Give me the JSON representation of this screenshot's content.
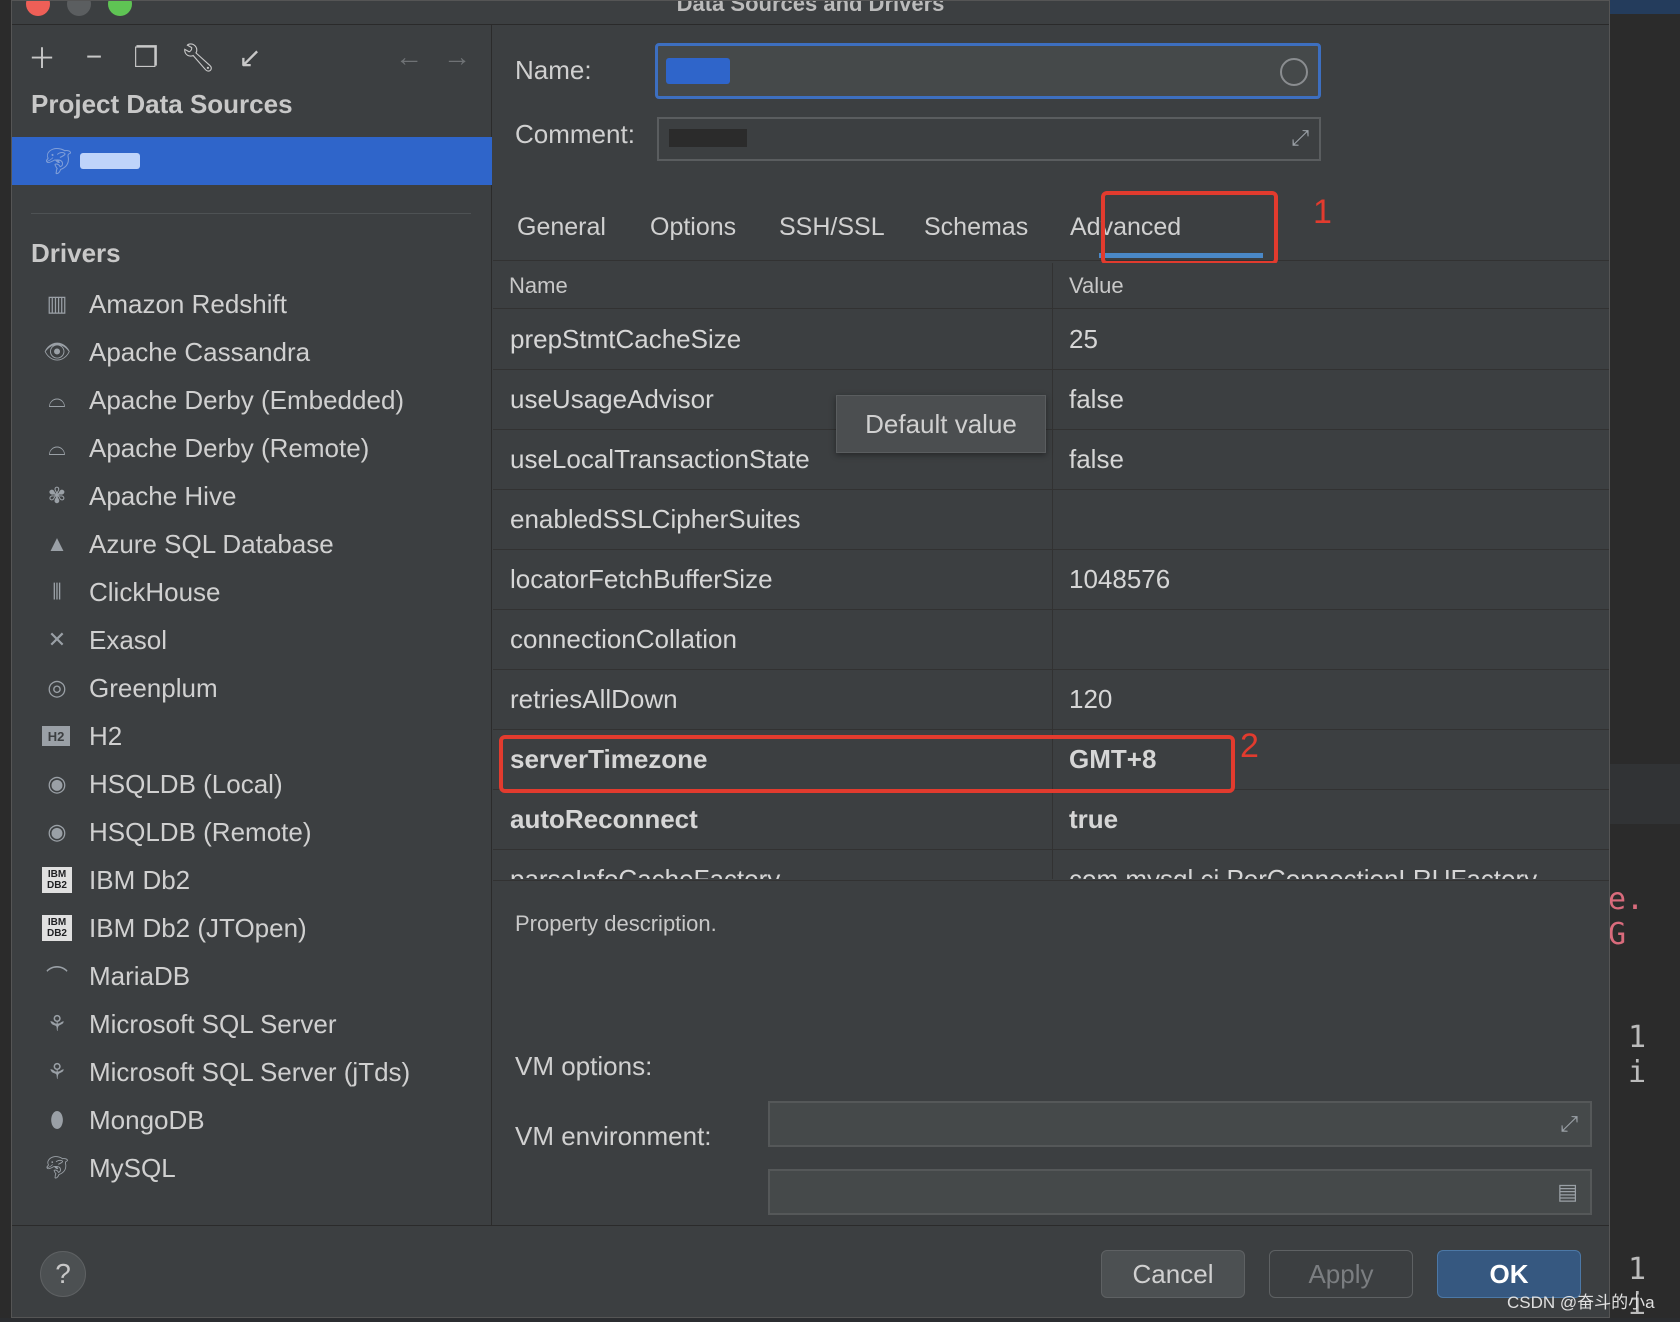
{
  "window": {
    "title": "Data Sources and Drivers"
  },
  "toolbar": {
    "add_icon": "plus-icon",
    "remove_icon": "minus-icon",
    "duplicate_icon": "copy-icon",
    "settings_icon": "wrench-icon",
    "import_icon": "import-icon",
    "back_icon": "arrow-left-icon",
    "forward_icon": "arrow-right-icon"
  },
  "sidebar": {
    "project_title": "Project Data Sources",
    "drivers_title": "Drivers",
    "drivers": [
      {
        "label": "Amazon Redshift",
        "icon": "redshift-icon"
      },
      {
        "label": "Apache Cassandra",
        "icon": "eye-icon"
      },
      {
        "label": "Apache Derby (Embedded)",
        "icon": "hat-icon"
      },
      {
        "label": "Apache Derby (Remote)",
        "icon": "hat-icon"
      },
      {
        "label": "Apache Hive",
        "icon": "hive-icon"
      },
      {
        "label": "Azure SQL Database",
        "icon": "azure-icon"
      },
      {
        "label": "ClickHouse",
        "icon": "clickhouse-icon"
      },
      {
        "label": "Exasol",
        "icon": "x-icon"
      },
      {
        "label": "Greenplum",
        "icon": "greenplum-icon"
      },
      {
        "label": "H2",
        "icon": "h2-icon"
      },
      {
        "label": "HSQLDB (Local)",
        "icon": "hsqldb-icon"
      },
      {
        "label": "HSQLDB (Remote)",
        "icon": "hsqldb-icon"
      },
      {
        "label": "IBM Db2",
        "icon": "ibm-db2-icon"
      },
      {
        "label": "IBM Db2 (JTOpen)",
        "icon": "ibm-db2-icon"
      },
      {
        "label": "MariaDB",
        "icon": "seal-icon"
      },
      {
        "label": "Microsoft SQL Server",
        "icon": "mssql-icon"
      },
      {
        "label": "Microsoft SQL Server (jTds)",
        "icon": "mssql-icon"
      },
      {
        "label": "MongoDB",
        "icon": "leaf-icon"
      },
      {
        "label": "MySQL",
        "icon": "dolphin-icon"
      }
    ]
  },
  "form": {
    "name_label": "Name:",
    "comment_label": "Comment:"
  },
  "tabs": [
    {
      "label": "General"
    },
    {
      "label": "Options"
    },
    {
      "label": "SSH/SSL"
    },
    {
      "label": "Schemas"
    },
    {
      "label": "Advanced",
      "active": true
    }
  ],
  "annotations": {
    "first": "1",
    "second": "2",
    "color": "#e23b2e"
  },
  "table": {
    "headers": {
      "name": "Name",
      "value": "Value"
    },
    "rows": [
      {
        "name": "prepStmtCacheSize",
        "value": "25"
      },
      {
        "name": "useUsageAdvisor",
        "value": "false"
      },
      {
        "name": "useLocalTransactionState",
        "value": "false"
      },
      {
        "name": "enabledSSLCipherSuites",
        "value": ""
      },
      {
        "name": "locatorFetchBufferSize",
        "value": "1048576"
      },
      {
        "name": "connectionCollation",
        "value": ""
      },
      {
        "name": "retriesAllDown",
        "value": "120"
      },
      {
        "name": "serverTimezone",
        "value": "GMT+8",
        "bold": true
      },
      {
        "name": "autoReconnect",
        "value": "true",
        "bold": true
      },
      {
        "name": "parseInfoCacheFactory",
        "value": "com.mysql.cj.PerConnectionLRUFactory"
      }
    ],
    "tooltip": "Default value"
  },
  "description": "Property description.",
  "vm": {
    "options_label": "VM options:",
    "environment_label": "VM environment:"
  },
  "footer": {
    "help": "?",
    "cancel": "Cancel",
    "apply": "Apply",
    "ok": "OK"
  },
  "watermark": "CSDN @奋斗的小a",
  "ide": {
    "code1": "e. G",
    "code2": "1 i",
    "code3": "1 i"
  },
  "colors": {
    "accent": "#2f65ca",
    "tab_underline": "#4a88c7",
    "ok_button": "#365880"
  }
}
